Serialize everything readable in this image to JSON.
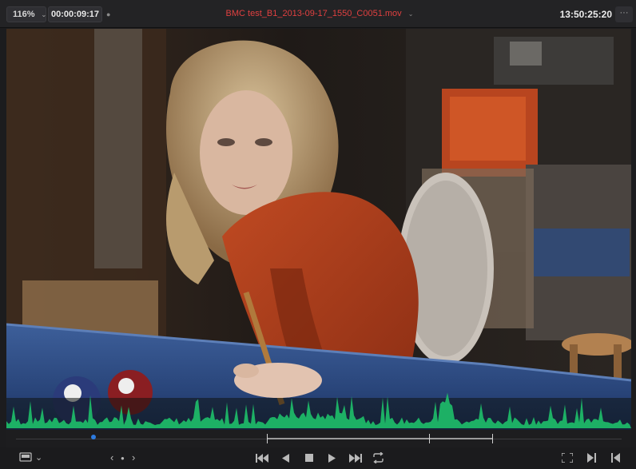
{
  "toolbar": {
    "zoom_value": "116%",
    "zoom_caret": "⌄",
    "source_timecode": "00:00:09:17",
    "clip_name": "BMC test_B1_2013-09-17_1550_C0051.mov",
    "clip_caret": "⌄",
    "record_timecode": "13:50:25:20",
    "more_label": "···",
    "marker_dot": "●"
  },
  "transport": {
    "nav_prev": "‹",
    "nav_dot": "●",
    "nav_next": "›",
    "view_caret": "⌄"
  },
  "colors": {
    "clip_name": "#e04040",
    "waveform": "#1ec06a",
    "playhead": "#2d7be0"
  },
  "icons": [
    "viewer-mode-icon",
    "go-to-start-icon",
    "play-reverse-icon",
    "stop-icon",
    "play-icon",
    "go-to-end-icon",
    "loop-icon",
    "fullscreen-icon",
    "mark-in-icon",
    "mark-out-icon"
  ]
}
